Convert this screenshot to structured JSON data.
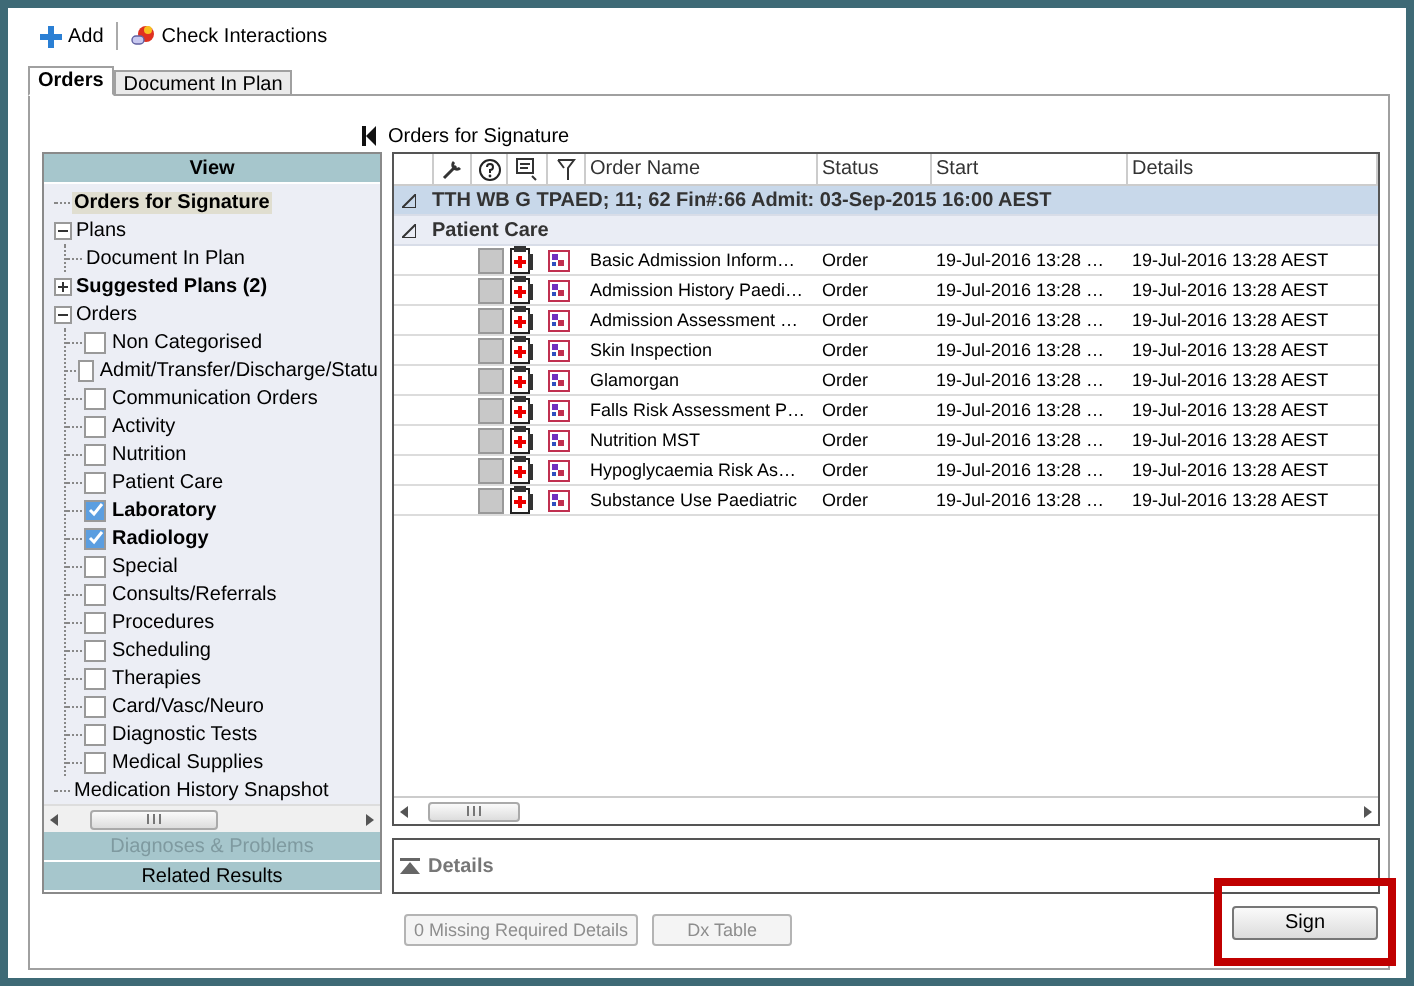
{
  "toolbar": [
    {
      "label": "Add"
    },
    {
      "label": "Check Interactions"
    }
  ],
  "tabs": [
    {
      "label": "Orders",
      "selected": true
    },
    {
      "label": "Document In Plan",
      "selected": false
    }
  ],
  "view": {
    "title": "View",
    "tree": [
      {
        "label": "Orders for Signature",
        "bold": true,
        "selected": true
      },
      {
        "label": "Plans",
        "bold": false,
        "selected": false,
        "expanded": true,
        "children": [
          {
            "label": "Document In Plan",
            "selected": false
          }
        ]
      },
      {
        "label": "Suggested Plans (2)",
        "bold": true,
        "selected": false,
        "expanded": false
      },
      {
        "label": "Orders",
        "bold": false,
        "selected": false,
        "expanded": true,
        "children": [
          {
            "label": "Non Categorised",
            "checked": false
          },
          {
            "label": "Admit/Transfer/Discharge/Statu",
            "checked": false
          },
          {
            "label": "Communication Orders",
            "checked": false
          },
          {
            "label": "Activity",
            "checked": false
          },
          {
            "label": "Nutrition",
            "checked": false
          },
          {
            "label": "Patient Care",
            "checked": false
          },
          {
            "label": "Laboratory",
            "checked": true
          },
          {
            "label": "Radiology",
            "checked": true
          },
          {
            "label": "Special",
            "checked": false
          },
          {
            "label": "Consults/Referrals",
            "checked": false
          },
          {
            "label": "Procedures",
            "checked": false
          },
          {
            "label": "Scheduling",
            "checked": false
          },
          {
            "label": "Therapies",
            "checked": false
          },
          {
            "label": "Card/Vasc/Neuro",
            "checked": false
          },
          {
            "label": "Diagnostic Tests",
            "checked": false
          },
          {
            "label": "Medical Supplies",
            "checked": false
          }
        ]
      },
      {
        "label": "Medication History Snapshot",
        "bold": false,
        "selected": false
      }
    ],
    "sections": [
      {
        "label": "Diagnoses & Problems",
        "disabled": true
      },
      {
        "label": "Related Results",
        "disabled": false
      }
    ]
  },
  "orders": {
    "title": "Orders for Signature",
    "columns": [
      "Order Name",
      "Status",
      "Start",
      "Details"
    ],
    "encounter": "TTH WB G TPAED; 11; 62  Fin#:66  Admit: 03-Sep-2015 16:00 AEST",
    "group": "Patient Care",
    "rows": [
      {
        "name": "Basic Admission Inform…",
        "status": "Order",
        "start": "19-Jul-2016 13:28 …",
        "details": "19-Jul-2016 13:28 AEST"
      },
      {
        "name": "Admission History Paedi…",
        "status": "Order",
        "start": "19-Jul-2016 13:28 …",
        "details": "19-Jul-2016 13:28 AEST"
      },
      {
        "name": "Admission Assessment …",
        "status": "Order",
        "start": "19-Jul-2016 13:28 …",
        "details": "19-Jul-2016 13:28 AEST"
      },
      {
        "name": "Skin Inspection",
        "status": "Order",
        "start": "19-Jul-2016 13:28 …",
        "details": "19-Jul-2016 13:28 AEST"
      },
      {
        "name": "Glamorgan",
        "status": "Order",
        "start": "19-Jul-2016 13:28 …",
        "details": "19-Jul-2016 13:28 AEST"
      },
      {
        "name": "Falls Risk Assessment P…",
        "status": "Order",
        "start": "19-Jul-2016 13:28 …",
        "details": "19-Jul-2016 13:28 AEST"
      },
      {
        "name": "Nutrition MST",
        "status": "Order",
        "start": "19-Jul-2016 13:28 …",
        "details": "19-Jul-2016 13:28 AEST"
      },
      {
        "name": "Hypoglycaemia Risk As…",
        "status": "Order",
        "start": "19-Jul-2016 13:28 …",
        "details": "19-Jul-2016 13:28 AEST"
      },
      {
        "name": "Substance Use Paediatric",
        "status": "Order",
        "start": "19-Jul-2016 13:28 …",
        "details": "19-Jul-2016 13:28 AEST"
      }
    ],
    "details_title": "Details"
  },
  "footer": {
    "buttons": [
      {
        "label": "0 Missing Required Details",
        "disabled": true
      },
      {
        "label": "Dx Table",
        "disabled": true
      }
    ],
    "sign": {
      "label": "Sign",
      "highlighted": true
    }
  }
}
